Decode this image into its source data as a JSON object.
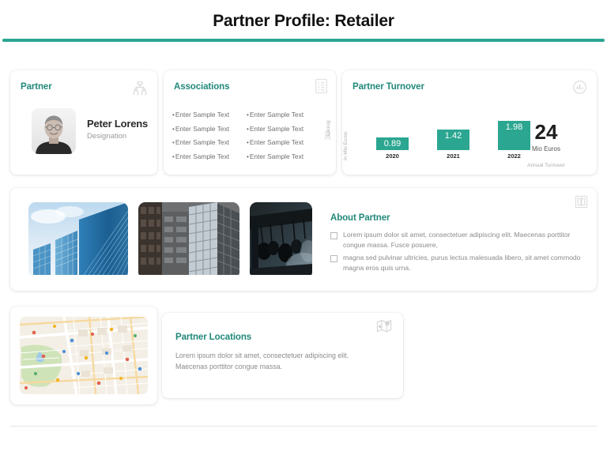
{
  "header": {
    "title": "Partner Profile: Retailer",
    "accent_color": "#2ba691"
  },
  "partner_card": {
    "title": "Partner",
    "icon": "partnership-people-icon",
    "person_name": "Peter Lorens",
    "person_role": "Designation"
  },
  "associations_card": {
    "title": "Associations",
    "icon": "list-document-icon",
    "side_label": "Brands",
    "side_icon": "badge-icon",
    "column_left": [
      "Enter Sample Text",
      "Enter Sample Text",
      "Enter Sample Text",
      "Enter Sample Text"
    ],
    "column_right": [
      "Enter Sample Text",
      "Enter Sample Text",
      "Enter Sample Text",
      "Enter Sample Text"
    ]
  },
  "turnover_card": {
    "title": "Partner Turnover",
    "icon": "bar-chart-circle-icon",
    "axis_label": "In Mio Euros",
    "kpi_value": "24",
    "kpi_unit": "Mio Euros",
    "kpi_caption": "Annual Turnover"
  },
  "chart_data": {
    "type": "bar",
    "title": "Partner Turnover",
    "categories": [
      "2020",
      "2021",
      "2022"
    ],
    "values": [
      0.89,
      1.42,
      1.98
    ],
    "value_labels": [
      "0.89",
      "1.42",
      "1.98"
    ],
    "xlabel": "",
    "ylabel": "In Mio Euros",
    "ylim": [
      0,
      2.2
    ],
    "grid": false,
    "legend": false,
    "series_color": "#2ba691",
    "annotations": [
      {
        "text": "24",
        "label": "Mio Euros",
        "caption": "Annual Turnover"
      }
    ]
  },
  "about_card": {
    "title": "About Partner",
    "icon": "building-window-icon",
    "bullets": [
      "Lorem ipsum dolor sit amet, consectetuer adipiscing elit. Maecenas porttitor congue massa. Fusce posuere,",
      "magna sed pulvinar ultricies, purus lectus malesuada libero, sit amet commodo magna eros quis urna."
    ],
    "thumbnails": [
      "glass-skyscrapers-photo",
      "city-buildings-photo",
      "industrial-structure-photo"
    ]
  },
  "locations_card": {
    "map_thumbnail": "city-map-photo",
    "title": "Partner Locations",
    "icon": "map-location-icon",
    "body": "Lorem ipsum dolor sit amet, consectetuer adipiscing elit. Maecenas porttitor congue massa."
  }
}
